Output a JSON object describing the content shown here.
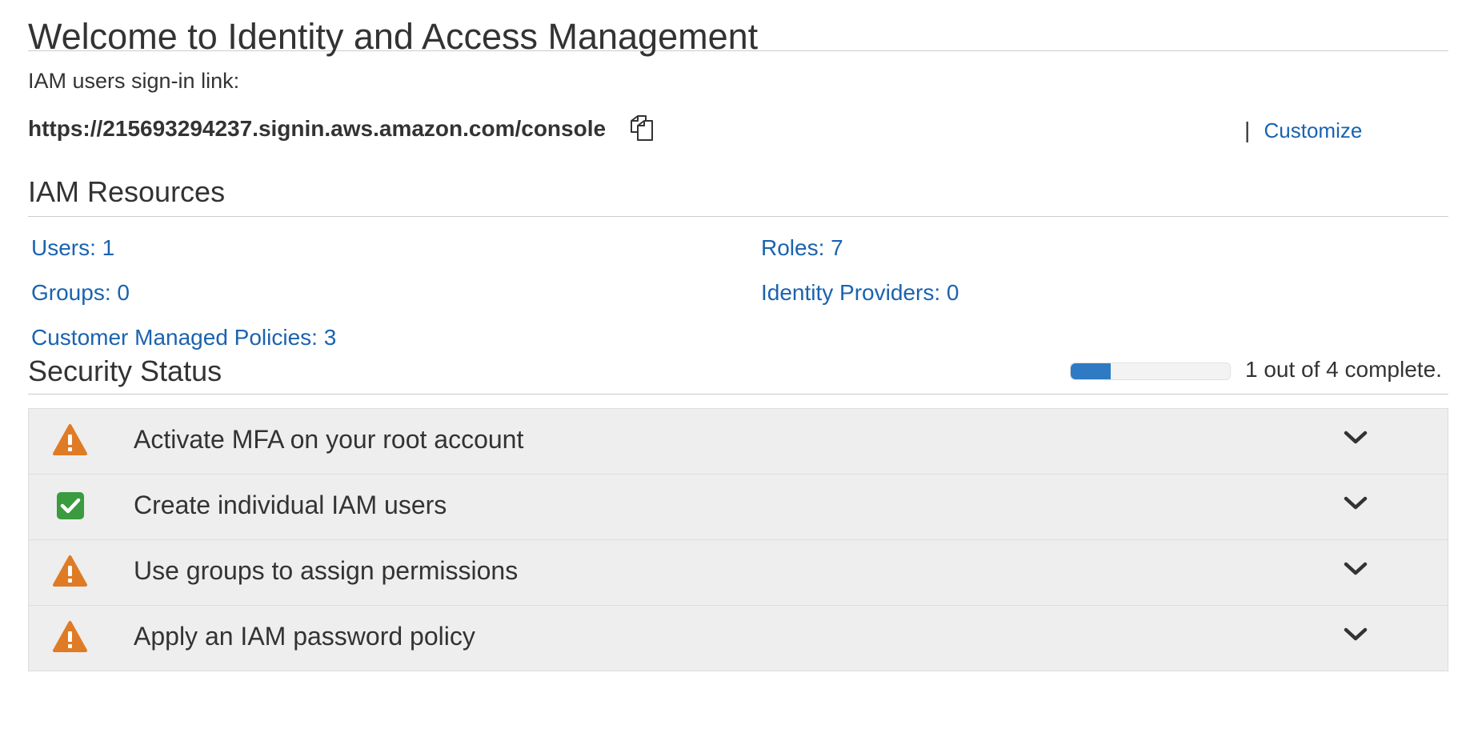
{
  "page": {
    "title": "Welcome to Identity and Access Management"
  },
  "signin": {
    "label": "IAM users sign-in link:",
    "url": "https://215693294237.signin.aws.amazon.com/console",
    "copy_icon": "copy-icon",
    "separator": "|",
    "customize_label": "Customize"
  },
  "resources": {
    "title": "IAM Resources",
    "items": [
      {
        "label": "Users: 1"
      },
      {
        "label": "Roles: 7"
      },
      {
        "label": "Groups: 0"
      },
      {
        "label": "Identity Providers: 0"
      },
      {
        "label": "Customer Managed Policies: 3"
      }
    ]
  },
  "security": {
    "title": "Security Status",
    "progress_fraction": 0.25,
    "progress_text": "1 out of 4 complete.",
    "progress_color": "#2e7bc4",
    "items": [
      {
        "label": "Activate MFA on your root account",
        "status": "warning",
        "icon": "warning-icon"
      },
      {
        "label": "Create individual IAM users",
        "status": "complete",
        "icon": "checkmark-icon"
      },
      {
        "label": "Use groups to assign permissions",
        "status": "warning",
        "icon": "warning-icon"
      },
      {
        "label": "Apply an IAM password policy",
        "status": "warning",
        "icon": "warning-icon"
      }
    ],
    "colors": {
      "warning": "#e07b25",
      "complete": "#3a9b3f"
    }
  }
}
